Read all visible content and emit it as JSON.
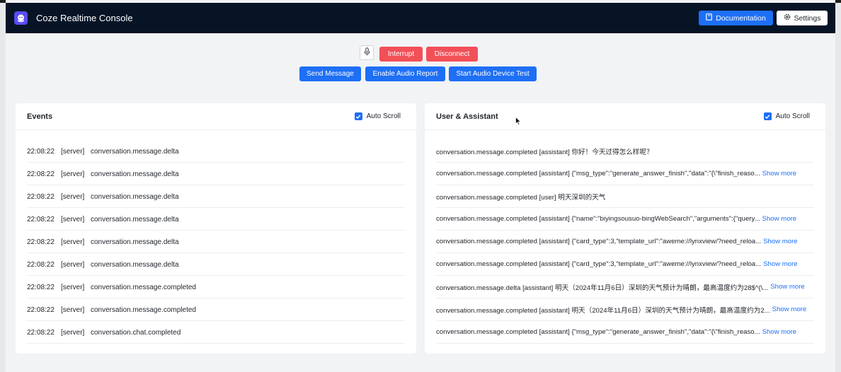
{
  "header": {
    "title": "Coze Realtime Console",
    "logo_icon": "coze-logo-icon",
    "documentation_label": "Documentation",
    "settings_label": "Settings"
  },
  "controls": {
    "mic_icon": "microphone-icon",
    "interrupt_label": "Interrupt",
    "disconnect_label": "Disconnect",
    "send_message_label": "Send Message",
    "enable_audio_report_label": "Enable Audio Report",
    "start_audio_device_test_label": "Start Audio Device Test"
  },
  "events": {
    "title": "Events",
    "auto_scroll_label": "Auto Scroll",
    "auto_scroll_checked": true,
    "rows": [
      {
        "time": "22:08:22",
        "source": "[server]",
        "event": "conversation.message.delta"
      },
      {
        "time": "22:08:22",
        "source": "[server]",
        "event": "conversation.message.delta"
      },
      {
        "time": "22:08:22",
        "source": "[server]",
        "event": "conversation.message.delta"
      },
      {
        "time": "22:08:22",
        "source": "[server]",
        "event": "conversation.message.delta"
      },
      {
        "time": "22:08:22",
        "source": "[server]",
        "event": "conversation.message.delta"
      },
      {
        "time": "22:08:22",
        "source": "[server]",
        "event": "conversation.message.delta"
      },
      {
        "time": "22:08:22",
        "source": "[server]",
        "event": "conversation.message.completed"
      },
      {
        "time": "22:08:22",
        "source": "[server]",
        "event": "conversation.message.completed"
      },
      {
        "time": "22:08:22",
        "source": "[server]",
        "event": "conversation.chat.completed"
      }
    ]
  },
  "chat": {
    "title": "User & Assistant",
    "auto_scroll_label": "Auto Scroll",
    "auto_scroll_checked": true,
    "rows": [
      {
        "text": "conversation.message.completed [assistant] 你好！今天过得怎么样呢？",
        "more": ""
      },
      {
        "text": "conversation.message.completed [assistant] {\"msg_type\":\"generate_answer_finish\",\"data\":\"{\\\"finish_reaso...",
        "more": "Show more"
      },
      {
        "text": "conversation.message.completed [user] 明天深圳的天气",
        "more": ""
      },
      {
        "text": "conversation.message.completed [assistant] {\"name\":\"biyingsousuo-bingWebSearch\",\"arguments\":{\"query...",
        "more": "Show more"
      },
      {
        "text": "conversation.message.completed [assistant] {\"card_type\":3,\"template_url\":\"aweme://lynxview/?need_reloa...",
        "more": "Show more"
      },
      {
        "text": "conversation.message.completed [assistant] {\"card_type\":3,\"template_url\":\"aweme://lynxview/?need_reloa...",
        "more": "Show more"
      },
      {
        "text": "conversation.message.delta [assistant] 明天（2024年11月6日）深圳的天气预计为晴朗，最高温度约为28$^{\\...",
        "more": "Show more"
      },
      {
        "text": "conversation.message.completed [assistant] 明天（2024年11月6日）深圳的天气预计为晴朗，最高温度约为2...",
        "more": "Show more"
      },
      {
        "text": "conversation.message.completed [assistant] {\"msg_type\":\"generate_answer_finish\",\"data\":\"{\\\"finish_reaso...",
        "more": "Show more"
      }
    ]
  }
}
